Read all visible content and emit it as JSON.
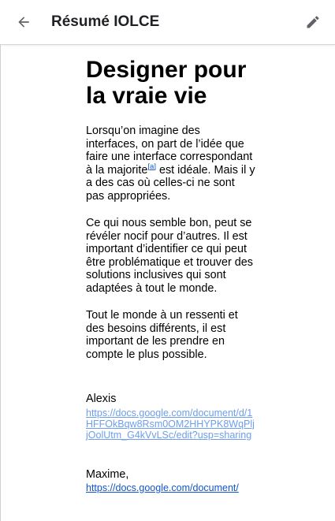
{
  "appbar": {
    "title": "Résumé IOLCE",
    "back_icon": "arrow-back-icon",
    "edit_icon": "pencil-edit-icon"
  },
  "document": {
    "title": "Designer pour la vraie vie",
    "para1_before": "Lorsqu’on imagine des interfaces, on part de l’idée que faire une interface correspondant à la majorite",
    "para1_ref": "[a]",
    "para1_after": " est idéale. Mais il y a des cas où celles-ci ne sont pas appropriées.",
    "para2": "Ce qui nous semble bon, peut se révéler nocif pour d’autres. Il est important d’identifier ce qui peut être problématique et trouver des solutions inclusives qui sont adaptées à tout le monde.",
    "para3": "Tout le monde à un ressenti et des besoins différents, il est important de les prendre en compte le plus possible.",
    "signatures": [
      {
        "name": "Alexis",
        "link": "https://docs.google.com/document/d/1HFFOkBqw8Rsm0OM2HHYPK8WqPljjOolUtm_G4kVvLSc/edit?usp=sharing"
      },
      {
        "name": "Maxime,",
        "link": "https://docs.google.com/document/"
      }
    ]
  },
  "colors": {
    "link_light": "#6d9eeb",
    "link_dark": "#1155cc",
    "title_text": "#202124"
  }
}
